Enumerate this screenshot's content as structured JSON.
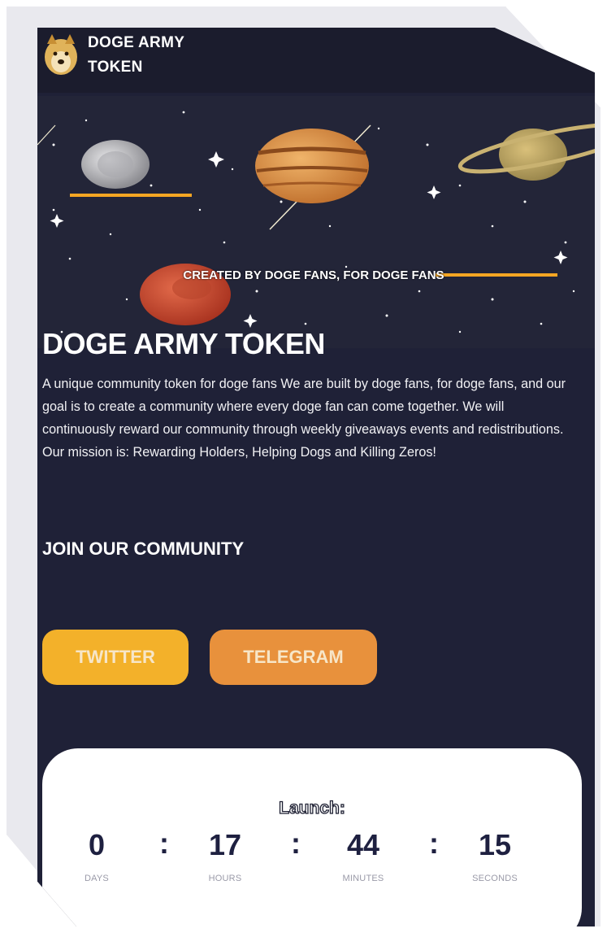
{
  "header": {
    "brand_line1": "DOGE ARMY",
    "brand_line2": "TOKEN",
    "logo_icon": "doge-logo-icon"
  },
  "hero": {
    "tagline": "CREATED BY DOGE FANS, FOR DOGE FANS"
  },
  "main": {
    "title": "DOGE ARMY TOKEN",
    "description": "A unique community token for doge fans We are built by doge fans, for doge fans, and our goal is to create a community where every doge fan can come together. We will continuously reward our community through weekly giveaways events and redistributions. Our mission is: Rewarding Holders, Helping Dogs and Killing Zeros!",
    "community_heading": "JOIN OUR COMMUNITY"
  },
  "buttons": {
    "twitter": "TWITTER",
    "telegram": "TELEGRAM"
  },
  "countdown": {
    "label": "Launch:",
    "separator": ":",
    "days": "0",
    "hours": "17",
    "minutes": "44",
    "seconds": "15",
    "days_label": "DAYS",
    "hours_label": "HOURS",
    "minutes_label": "MINUTES",
    "seconds_label": "SECONDS"
  },
  "colors": {
    "background": "#1f2137",
    "twitter": "#f3b12a",
    "telegram": "#e8913c",
    "accent_line": "#f5a623"
  }
}
